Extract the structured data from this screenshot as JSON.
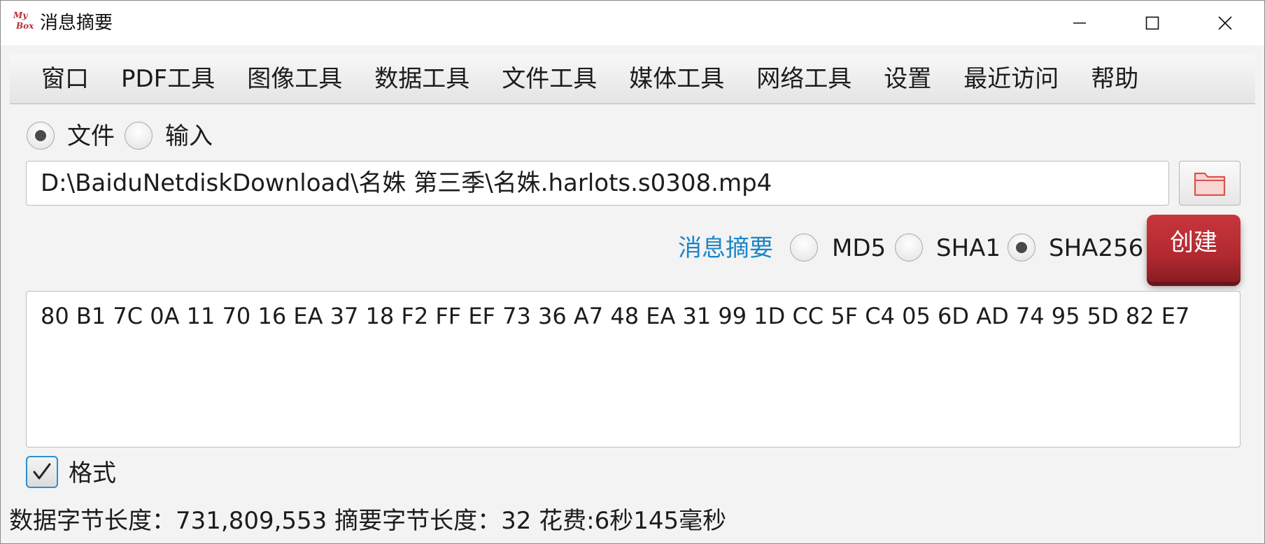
{
  "window": {
    "title": "消息摘要",
    "logo_line1": "My",
    "logo_line2": "Box"
  },
  "menu": [
    "窗口",
    "PDF工具",
    "图像工具",
    "数据工具",
    "文件工具",
    "媒体工具",
    "网络工具",
    "设置",
    "最近访问",
    "帮助"
  ],
  "source": {
    "file_label": "文件",
    "input_label": "输入",
    "selected": "文件"
  },
  "path_input": {
    "value": "D:\\BaiduNetdiskDownload\\名姝 第三季\\名姝.harlots.s0308.mp4"
  },
  "digest": {
    "link_label": "消息摘要",
    "algorithms": [
      "MD5",
      "SHA1",
      "SHA256"
    ],
    "selected": "SHA256",
    "create_label": "创建",
    "result": "80 B1 7C 0A 11 70 16 EA 37 18 F2 FF EF 73 36 A7 48 EA 31 99 1D CC 5F C4 05 6D AD 74 95 5D 82 E7"
  },
  "format_checkbox": {
    "label": "格式",
    "checked": true
  },
  "status": {
    "text": "数据字节长度：731,809,553  摘要字节长度：32  花费:6秒145毫秒"
  },
  "colors": {
    "accent_link": "#1a86c9",
    "create_button": "#b12a30",
    "checkbox_border": "#2d8fd2",
    "folder_icon": "#d9534f"
  },
  "icons": {
    "folder_button": "folder-open-icon",
    "minimize": "minimize-icon",
    "maximize": "maximize-icon",
    "close": "close-icon",
    "checkbox": "checkmark-icon"
  }
}
